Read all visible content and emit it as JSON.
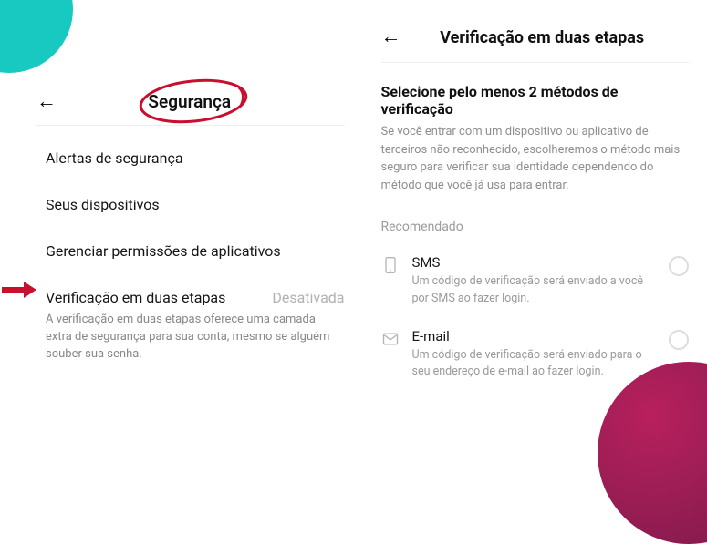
{
  "left": {
    "title": "Segurança",
    "items": [
      {
        "label": "Alertas de segurança"
      },
      {
        "label": "Seus dispositivos"
      },
      {
        "label": "Gerenciar permissões de aplicativos"
      },
      {
        "label": "Verificação em duas etapas",
        "status": "Desativada",
        "desc": "A verificação em duas etapas oferece uma camada extra de segurança para sua conta, mesmo se alguém souber sua senha."
      }
    ]
  },
  "right": {
    "title": "Verificação em duas etapas",
    "section_title": "Selecione pelo menos 2 métodos de verificação",
    "section_desc": "Se você entrar com um dispositivo ou aplicativo de terceiros não reconhecido, escolheremos o método mais seguro para verificar sua identidade dependendo do método que você já usa para entrar.",
    "recommended_label": "Recomendado",
    "methods": [
      {
        "icon": "phone",
        "label": "SMS",
        "desc": "Um código de verificação será enviado a você por SMS ao fazer login."
      },
      {
        "icon": "mail",
        "label": "E-mail",
        "desc": "Um código de verificação será enviado para o seu endereço de e-mail ao fazer login."
      }
    ]
  },
  "colors": {
    "accent_teal": "#18c9c1",
    "accent_magenta": "#b8205d",
    "annotation_red": "#c8102e"
  }
}
